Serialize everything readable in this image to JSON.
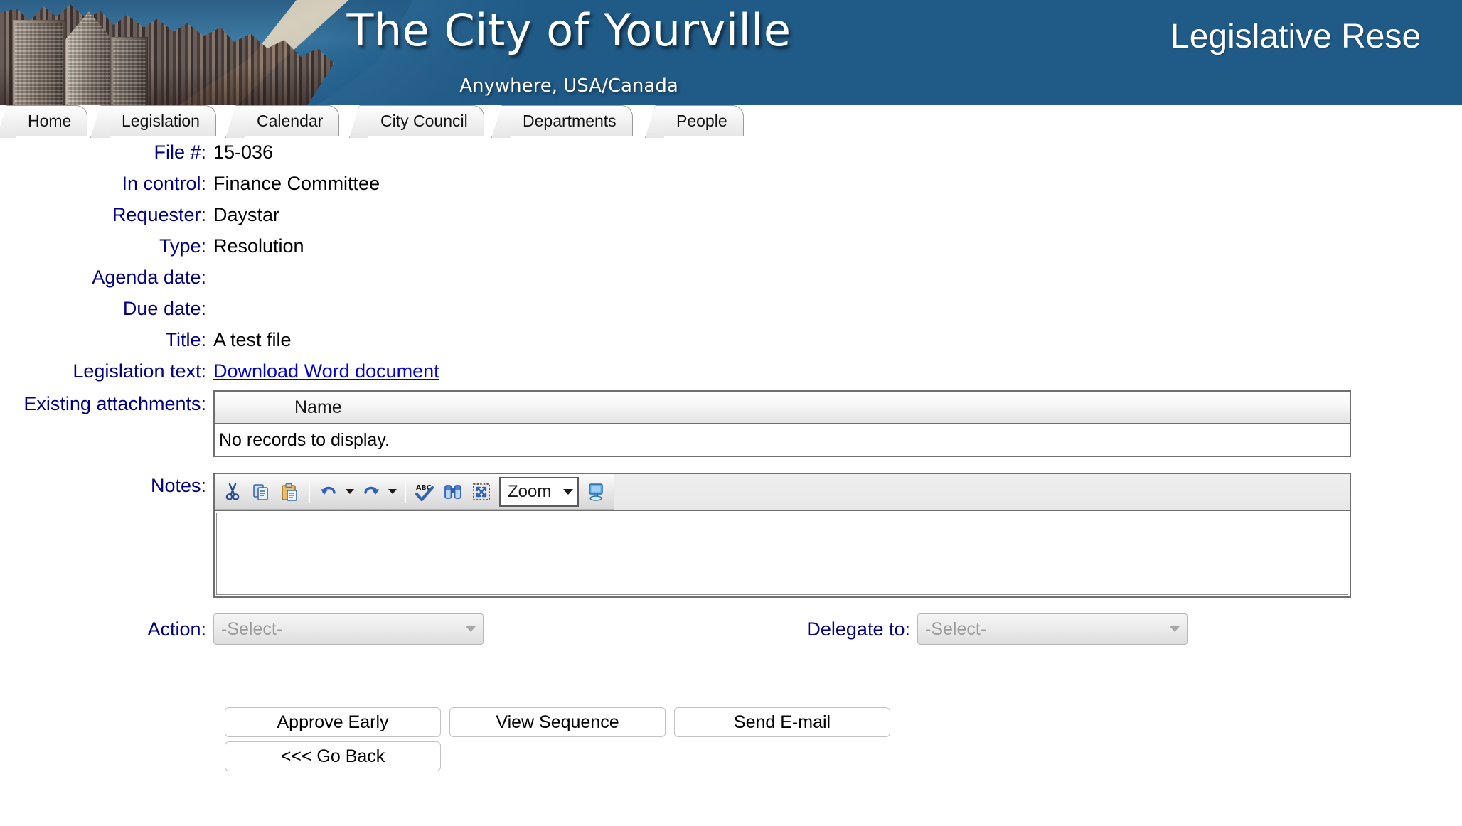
{
  "banner": {
    "title": "The City of Yourville",
    "subtitle": "Anywhere, USA/Canada",
    "right_title": "Legislative Rese",
    "blue": "#205a86"
  },
  "tabs": [
    {
      "label": "Home"
    },
    {
      "label": "Legislation"
    },
    {
      "label": "Calendar"
    },
    {
      "label": "City Council"
    },
    {
      "label": "Departments"
    },
    {
      "label": "People"
    }
  ],
  "form": {
    "file_number": {
      "label": "File #:",
      "value": "15-036"
    },
    "in_control": {
      "label": "In control:",
      "value": "Finance Committee"
    },
    "requester": {
      "label": "Requester:",
      "value": "Daystar"
    },
    "type": {
      "label": "Type:",
      "value": "Resolution"
    },
    "agenda_date": {
      "label": "Agenda date:",
      "value": ""
    },
    "due_date": {
      "label": "Due date:",
      "value": ""
    },
    "title": {
      "label": "Title:",
      "value": "A test file"
    },
    "legislation_text": {
      "label": "Legislation text:",
      "link": "Download Word document"
    },
    "attachments": {
      "label": "Existing attachments:",
      "columns": [
        "Name"
      ],
      "empty_message": "No records to display.",
      "rows": []
    },
    "notes": {
      "label": "Notes:",
      "value": "",
      "toolbar": {
        "cut": "cut-icon",
        "copy": "copy-icon",
        "paste": "paste-icon",
        "undo": "undo-icon",
        "redo": "redo-icon",
        "spellcheck": "spellcheck-icon",
        "find": "find-icon",
        "select_all": "select-all-icon",
        "zoom_label": "Zoom",
        "preview": "preview-monitor-icon"
      }
    },
    "action": {
      "label": "Action:",
      "value": "-Select-"
    },
    "delegate_to": {
      "label": "Delegate to:",
      "value": "-Select-"
    }
  },
  "buttons": {
    "approve_early": "Approve Early",
    "view_sequence": "View Sequence",
    "send_email": "Send E-mail",
    "go_back": "<<< Go Back"
  }
}
